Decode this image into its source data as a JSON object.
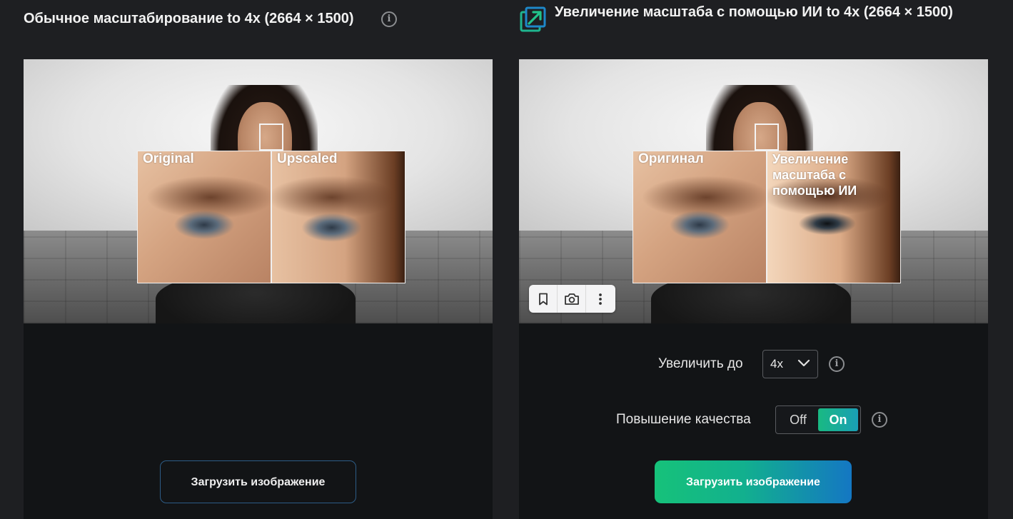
{
  "left_panel": {
    "title": "Обычное масштабирование to 4x (2664 × 1500)",
    "zoom_labels": {
      "original": "Original",
      "upscaled": "Upscaled"
    },
    "upload_button": "Загрузить изображение"
  },
  "right_panel": {
    "title": "Увеличение масштаба с помощью ИИ to 4x (2664 × 1500)",
    "zoom_labels": {
      "original": "Оригинал",
      "upscaled": "Увеличение масштаба с помощью ИИ"
    },
    "toolbar_icons": [
      "bookmark-icon",
      "camera-icon",
      "more-vertical-icon"
    ],
    "scale": {
      "label": "Увеличить до",
      "value": "4x",
      "options": [
        "4x"
      ]
    },
    "enhance": {
      "label": "Повышение качества",
      "off_label": "Off",
      "on_label": "On",
      "selected": "On"
    },
    "upload_button": "Загрузить изображение"
  },
  "colors": {
    "background": "#1e1f22",
    "bottom_area": "#121416",
    "toggle_on_gradient": [
      "#19b982",
      "#1a9fb5"
    ],
    "upload_gradient": [
      "#16c27a",
      "#1477c3"
    ],
    "outline_button_border": "#2d5c86"
  }
}
